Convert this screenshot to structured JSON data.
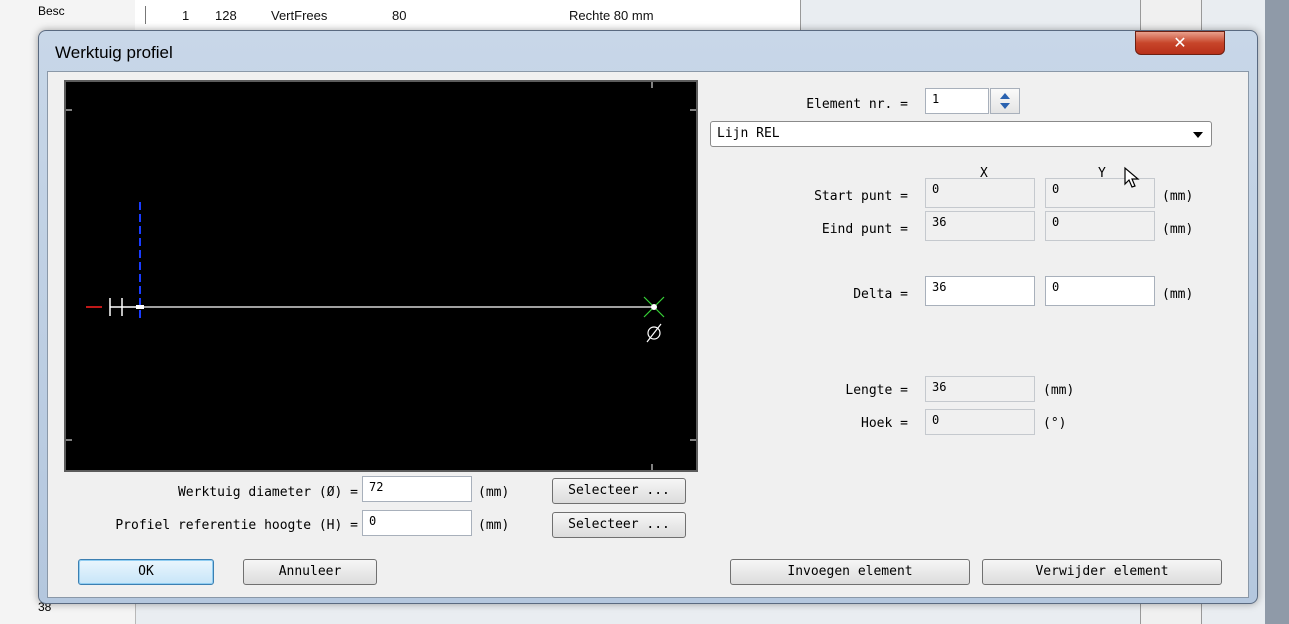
{
  "background": {
    "besc_label": "Besc",
    "row": {
      "nr": "1",
      "code": "128",
      "type": "VertFrees",
      "value": "80",
      "description": "Rechte 80 mm"
    },
    "bottom_label": "38"
  },
  "dialog": {
    "title": "Werktuig profiel",
    "close_icon": "close-icon",
    "element_nr_label": "Element nr. =",
    "element_nr_value": "1",
    "type_select_value": "Lijn REL",
    "col_x": "X",
    "col_y": "Y",
    "start_label": "Start punt =",
    "start_x": "0",
    "start_y": "0",
    "eind_label": "Eind punt =",
    "eind_x": "36",
    "eind_y": "0",
    "delta_label": "Delta =",
    "delta_x": "36",
    "delta_y": "0",
    "unit_mm": "(mm)",
    "lengte_label": "Lengte =",
    "lengte_value": "36",
    "hoek_label": "Hoek =",
    "hoek_value": "0",
    "unit_deg": "(°)",
    "diameter_label": "Werktuig diameter (Ø) =",
    "diameter_value": "72",
    "hoogte_label": "Profiel referentie hoogte (H) =",
    "hoogte_value": "0",
    "selecteer_label": "Selecteer ...",
    "ok_label": "OK",
    "cancel_label": "Annuleer",
    "insert_label": "Invoegen element",
    "delete_label": "Verwijder element",
    "canvas_h_marker": "H",
    "canvas_diameter_marker": "Ø"
  },
  "colors": {
    "canvas_bg": "#000000",
    "profile_line": "#ffffff",
    "axis_line": "#1a3cff",
    "ref_marker": "#ff2020",
    "end_marker": "#37d337"
  }
}
